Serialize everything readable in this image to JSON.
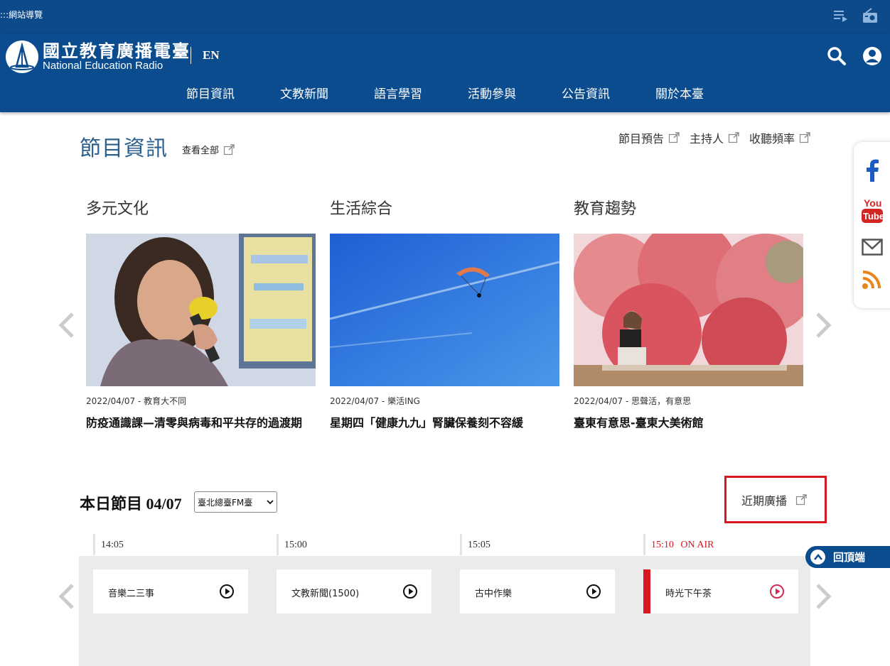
{
  "utility": {
    "skip_link": ":::網站導覽",
    "playlist_icon": "playlist-icon",
    "radio_icon": "radio-icon"
  },
  "header": {
    "logo_cn": "國立教育廣播電臺",
    "logo_en": "National Education Radio",
    "lang": "EN",
    "search_icon": "search-icon",
    "user_icon": "user-icon"
  },
  "nav": [
    "節目資訊",
    "文教新聞",
    "語言學習",
    "活動參與",
    "公告資訊",
    "關於本臺"
  ],
  "section": {
    "title": "節目資訊",
    "view_all": "查看全部",
    "links": [
      "節目預告",
      "主持人",
      "收聽頻率"
    ]
  },
  "cards": [
    {
      "category": "多元文化",
      "meta": "2022/04/07 - 教育大不同",
      "headline": "防疫通識課—清零與病毒和平共存的過渡期"
    },
    {
      "category": "生活綜合",
      "meta": "2022/04/07 - 樂活ING",
      "headline": "星期四「健康九九」腎臟保養刻不容緩"
    },
    {
      "category": "教育趨勢",
      "meta": "2022/04/07 - 思聲活，有意思",
      "headline": "臺東有意思-臺東大美術館"
    }
  ],
  "social": [
    "facebook-icon",
    "youtube-icon",
    "mail-icon",
    "rss-icon"
  ],
  "schedule": {
    "title": "本日節目",
    "date": "04/07",
    "station": "臺北總臺FM臺",
    "recent": "近期廣播",
    "on_air": "ON AIR",
    "slots": [
      {
        "time": "14:05",
        "program": "音樂二三事"
      },
      {
        "time": "15:00",
        "program": "文教新聞(1500)"
      },
      {
        "time": "15:05",
        "program": "古中作樂"
      },
      {
        "time": "15:10",
        "program": "時光下午茶"
      }
    ]
  },
  "back_to_top": "回頂端",
  "colors": {
    "brand_blue": "#0a4c8e",
    "accent_red": "#d8171f"
  }
}
